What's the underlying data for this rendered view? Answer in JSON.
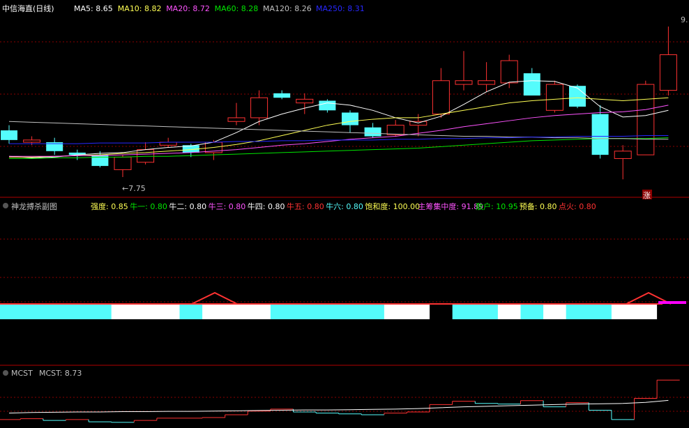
{
  "colors": {
    "background": "#000000",
    "up": "#ff3232",
    "down": "#54fcfc",
    "grid": "#8b0000",
    "separator": "#b00000",
    "label": "#c0c0c0",
    "title": "#ffffff"
  },
  "main_panel": {
    "title": "中信海直(日线)",
    "legend": [
      {
        "label": "MA5:",
        "value": "8.65",
        "color": "#ffffff"
      },
      {
        "label": "MA10:",
        "value": "8.82",
        "color": "#ffff54"
      },
      {
        "label": "MA20:",
        "value": "8.72",
        "color": "#ff54ff"
      },
      {
        "label": "MA60:",
        "value": "8.28",
        "color": "#00e600"
      },
      {
        "label": "MA120:",
        "value": "8.26",
        "color": "#c0c0c0"
      },
      {
        "label": "MA250:",
        "value": "8.31",
        "color": "#2828ff"
      }
    ],
    "low_marker": "←7.75",
    "high_marker": "9.",
    "up_badge": "涨"
  },
  "sub_panel_1": {
    "title": "神龙搏杀副图",
    "legend": [
      {
        "label": "强度:",
        "value": "0.85",
        "color": "#ffff54"
      },
      {
        "label": "牛一:",
        "value": "0.80",
        "color": "#00e600"
      },
      {
        "label": "牛二:",
        "value": "0.80",
        "color": "#ffffff"
      },
      {
        "label": "牛三:",
        "value": "0.80",
        "color": "#ff54ff"
      },
      {
        "label": "牛四:",
        "value": "0.80",
        "color": "#ffffff"
      },
      {
        "label": "牛五:",
        "value": "0.80",
        "color": "#ff3232"
      },
      {
        "label": "牛六:",
        "value": "0.80",
        "color": "#54fcfc"
      },
      {
        "label": "饱和度:",
        "value": "100.00",
        "color": "#ffff54"
      },
      {
        "label": "主筹集中度:",
        "value": "91.89",
        "color": "#ff54ff"
      },
      {
        "label": "散户:",
        "value": "10.95",
        "color": "#00e600"
      },
      {
        "label": "预备:",
        "value": "0.80",
        "color": "#ffff54"
      },
      {
        "label": "点火:",
        "value": "0.80",
        "color": "#ff3232"
      }
    ]
  },
  "sub_panel_2": {
    "title": "MCST",
    "legend": [
      {
        "label": "MCST:",
        "value": "8.73",
        "color": "#c0c0c0"
      }
    ]
  },
  "chart_data": [
    {
      "type": "candlestick",
      "y_range": [
        7.6,
        9.95
      ],
      "candles": [
        {
          "o": 8.38,
          "c": 8.25,
          "h": 8.45,
          "l": 8.2
        },
        {
          "o": 8.22,
          "c": 8.25,
          "h": 8.3,
          "l": 8.18
        },
        {
          "o": 8.22,
          "c": 8.1,
          "h": 8.28,
          "l": 8.05
        },
        {
          "o": 8.08,
          "c": 8.05,
          "h": 8.12,
          "l": 7.98
        },
        {
          "o": 8.05,
          "c": 7.9,
          "h": 8.1,
          "l": 7.88
        },
        {
          "o": 7.85,
          "c": 8.02,
          "h": 8.05,
          "l": 7.75
        },
        {
          "o": 7.95,
          "c": 8.12,
          "h": 8.22,
          "l": 7.92
        },
        {
          "o": 8.18,
          "c": 8.22,
          "h": 8.28,
          "l": 8.15
        },
        {
          "o": 8.18,
          "c": 8.08,
          "h": 8.2,
          "l": 8.02
        },
        {
          "o": 8.08,
          "c": 8.22,
          "h": 8.25,
          "l": 7.98
        },
        {
          "o": 8.5,
          "c": 8.55,
          "h": 8.75,
          "l": 8.45
        },
        {
          "o": 8.55,
          "c": 8.82,
          "h": 8.92,
          "l": 8.45
        },
        {
          "o": 8.88,
          "c": 8.82,
          "h": 8.92,
          "l": 8.8
        },
        {
          "o": 8.75,
          "c": 8.8,
          "h": 8.88,
          "l": 8.6
        },
        {
          "o": 8.78,
          "c": 8.65,
          "h": 8.8,
          "l": 8.62
        },
        {
          "o": 8.62,
          "c": 8.45,
          "h": 8.65,
          "l": 8.35
        },
        {
          "o": 8.42,
          "c": 8.3,
          "h": 8.48,
          "l": 8.28
        },
        {
          "o": 8.32,
          "c": 8.45,
          "h": 8.52,
          "l": 8.3
        },
        {
          "o": 8.45,
          "c": 8.5,
          "h": 8.6,
          "l": 8.3
        },
        {
          "o": 8.6,
          "c": 9.05,
          "h": 9.22,
          "l": 8.55
        },
        {
          "o": 9.0,
          "c": 9.05,
          "h": 9.45,
          "l": 8.92
        },
        {
          "o": 9.0,
          "c": 9.05,
          "h": 9.3,
          "l": 8.9
        },
        {
          "o": 9.02,
          "c": 9.32,
          "h": 9.4,
          "l": 8.95
        },
        {
          "o": 9.15,
          "c": 8.85,
          "h": 9.22,
          "l": 8.85
        },
        {
          "o": 8.65,
          "c": 9.0,
          "h": 9.05,
          "l": 8.62
        },
        {
          "o": 8.98,
          "c": 8.7,
          "h": 9.0,
          "l": 8.68
        },
        {
          "o": 8.6,
          "c": 8.05,
          "h": 8.72,
          "l": 8.0
        },
        {
          "o": 8.0,
          "c": 8.1,
          "h": 8.18,
          "l": 7.72
        },
        {
          "o": 8.05,
          "c": 9.0,
          "h": 9.05,
          "l": 8.05
        },
        {
          "o": 8.92,
          "c": 9.4,
          "h": 9.78,
          "l": 8.85
        }
      ],
      "ma": {
        "MA5": [
          8.03,
          8.01,
          8.02,
          8.05,
          8.07,
          8.08,
          8.12,
          8.15,
          8.17,
          8.22,
          8.35,
          8.5,
          8.6,
          8.68,
          8.75,
          8.72,
          8.65,
          8.55,
          8.48,
          8.57,
          8.73,
          8.9,
          9.03,
          9.05,
          9.04,
          8.95,
          8.7,
          8.56,
          8.58,
          8.65
        ],
        "MA10": [
          8.02,
          8.02,
          8.03,
          8.04,
          8.05,
          8.07,
          8.08,
          8.1,
          8.12,
          8.15,
          8.19,
          8.24,
          8.31,
          8.38,
          8.45,
          8.5,
          8.53,
          8.55,
          8.55,
          8.6,
          8.65,
          8.7,
          8.75,
          8.78,
          8.8,
          8.82,
          8.8,
          8.78,
          8.8,
          8.82
        ],
        "MA20": [
          8.03,
          8.03,
          8.03,
          8.04,
          8.04,
          8.05,
          8.06,
          8.07,
          8.08,
          8.1,
          8.12,
          8.15,
          8.18,
          8.2,
          8.23,
          8.26,
          8.28,
          8.3,
          8.34,
          8.38,
          8.43,
          8.47,
          8.51,
          8.55,
          8.58,
          8.6,
          8.62,
          8.63,
          8.66,
          8.72
        ],
        "MA60": [
          8.0,
          8.0,
          8.01,
          8.01,
          8.02,
          8.02,
          8.03,
          8.03,
          8.04,
          8.05,
          8.06,
          8.07,
          8.08,
          8.09,
          8.1,
          8.11,
          8.12,
          8.13,
          8.14,
          8.16,
          8.18,
          8.2,
          8.22,
          8.24,
          8.25,
          8.26,
          8.27,
          8.27,
          8.27,
          8.28
        ],
        "MA120": [
          8.5,
          8.49,
          8.48,
          8.47,
          8.46,
          8.45,
          8.44,
          8.43,
          8.42,
          8.41,
          8.4,
          8.39,
          8.38,
          8.37,
          8.36,
          8.35,
          8.34,
          8.33,
          8.32,
          8.31,
          8.3,
          8.3,
          8.29,
          8.29,
          8.28,
          8.28,
          8.27,
          8.27,
          8.26,
          8.26
        ],
        "MA250": [
          8.2,
          8.2,
          8.2,
          8.2,
          8.21,
          8.21,
          8.21,
          8.22,
          8.22,
          8.22,
          8.23,
          8.23,
          8.24,
          8.24,
          8.25,
          8.25,
          8.25,
          8.26,
          8.26,
          8.27,
          8.27,
          8.28,
          8.28,
          8.29,
          8.29,
          8.3,
          8.3,
          8.3,
          8.31,
          8.31
        ]
      }
    },
    {
      "type": "bar",
      "series_name": "神龙搏杀副图",
      "segments": [
        "cyan",
        "cyan",
        "cyan",
        "cyan",
        "cyan",
        "white",
        "white",
        "white",
        "cyan",
        "white",
        "white",
        "white",
        "cyan",
        "cyan",
        "cyan",
        "cyan",
        "cyan",
        "white",
        "white",
        "black",
        "cyan",
        "cyan",
        "white",
        "cyan",
        "white",
        "cyan",
        "cyan",
        "white",
        "white",
        "black"
      ]
    },
    {
      "type": "step",
      "series_name": "MCST",
      "y_range": [
        7.8,
        9.9
      ],
      "values": [
        8.05,
        8.08,
        8.02,
        8.05,
        7.97,
        7.95,
        8.02,
        8.1,
        8.1,
        8.12,
        8.22,
        8.35,
        8.42,
        8.32,
        8.28,
        8.25,
        8.22,
        8.28,
        8.32,
        8.58,
        8.7,
        8.62,
        8.6,
        8.72,
        8.5,
        8.65,
        8.38,
        8.05,
        8.8,
        9.45
      ],
      "cost_line": [
        8.28,
        8.3,
        8.31,
        8.32,
        8.32,
        8.33,
        8.33,
        8.34,
        8.34,
        8.35,
        8.36,
        8.37,
        8.38,
        8.39,
        8.39,
        8.4,
        8.41,
        8.42,
        8.44,
        8.47,
        8.5,
        8.52,
        8.54,
        8.56,
        8.58,
        8.6,
        8.61,
        8.62,
        8.66,
        8.73
      ]
    }
  ]
}
